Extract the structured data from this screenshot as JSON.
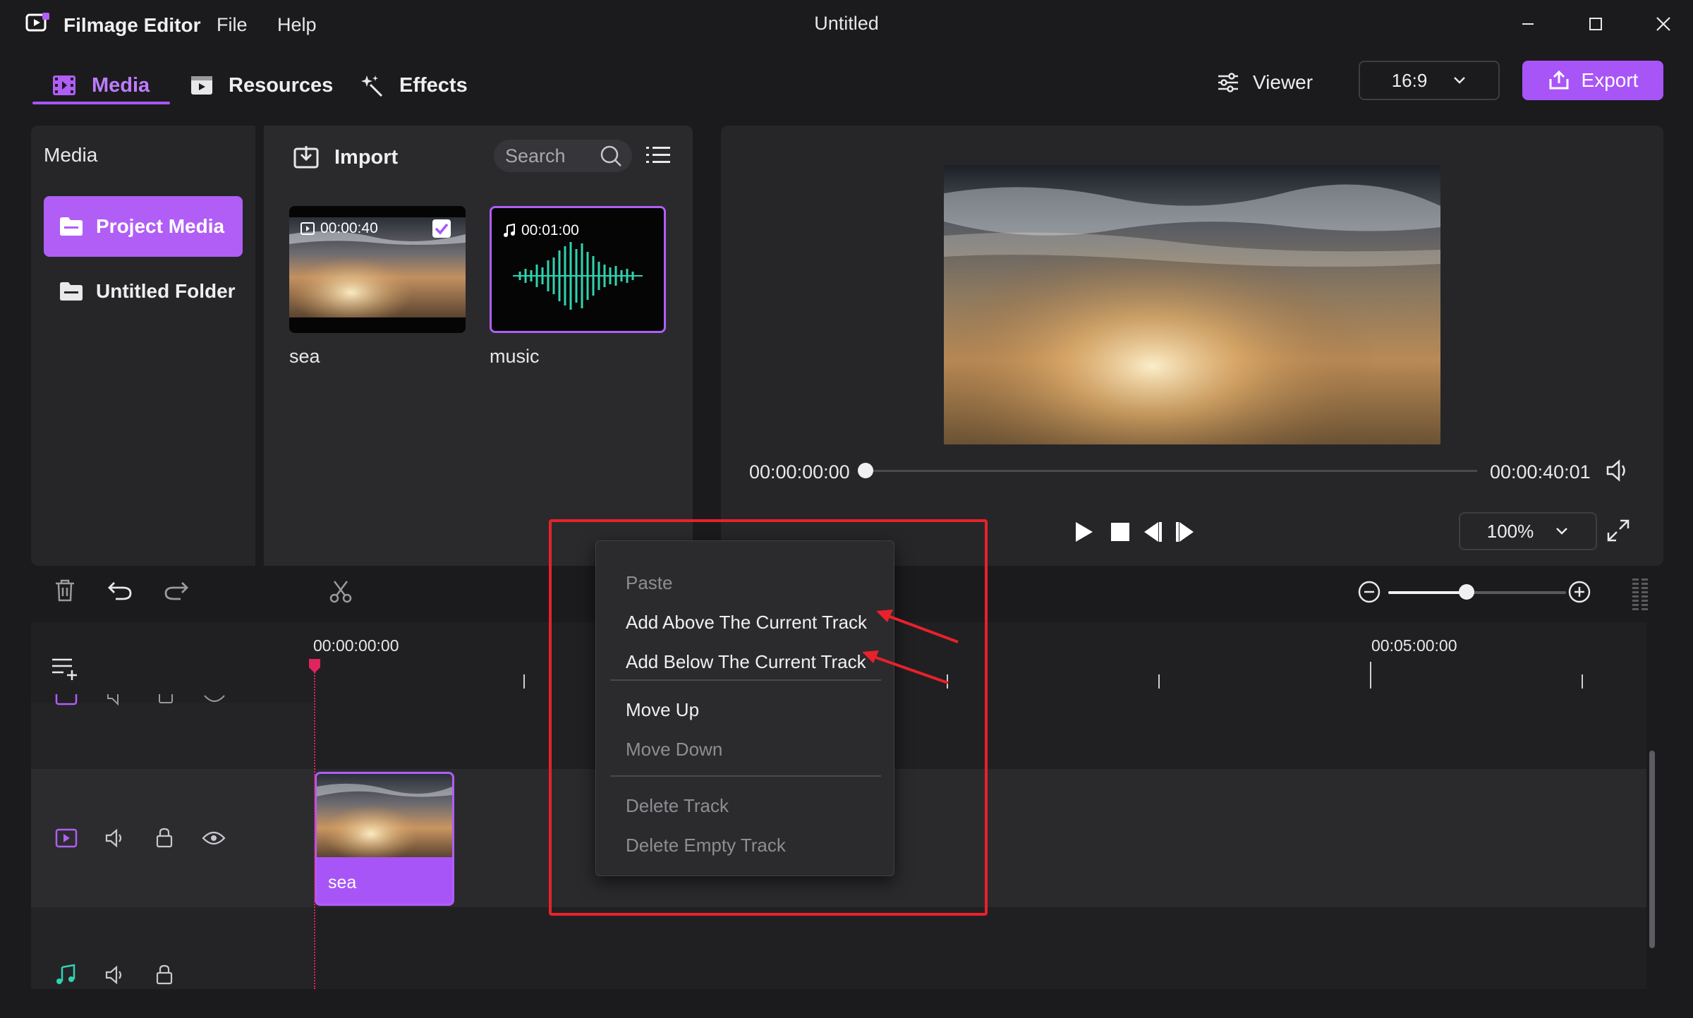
{
  "titlebar": {
    "app_name": "Filmage Editor",
    "menus": [
      "File",
      "Help"
    ],
    "window_title": "Untitled"
  },
  "toolbar": {
    "tabs": [
      {
        "label": "Media",
        "icon": "film-icon",
        "active": true
      },
      {
        "label": "Resources",
        "icon": "play-square-icon",
        "active": false
      },
      {
        "label": "Effects",
        "icon": "sparkle-icon",
        "active": false
      }
    ],
    "viewer_label": "Viewer",
    "aspect_ratio": "16:9",
    "export_label": "Export",
    "accent_color": "#a855f7"
  },
  "media_panel": {
    "heading": "Media",
    "folders": [
      {
        "label": "Project Media",
        "selected": true
      },
      {
        "label": "Untitled Folder",
        "selected": false
      }
    ],
    "import_label": "Import",
    "search_placeholder": "Search",
    "items": [
      {
        "name": "sea",
        "duration": "00:00:40",
        "type": "video",
        "checked": true
      },
      {
        "name": "music",
        "duration": "00:01:00",
        "type": "audio",
        "selected": true
      }
    ]
  },
  "preview": {
    "current_time": "00:00:00:00",
    "total_time": "00:00:40:01",
    "zoom": "100%"
  },
  "timeline": {
    "ruler_start": "00:00:00:00",
    "ruler_mark": "00:05:00:00",
    "clip_label": "sea"
  },
  "context_menu": {
    "items": [
      {
        "label": "Paste",
        "enabled": false
      },
      {
        "label": "Add Above The Current Track",
        "enabled": true
      },
      {
        "label": "Add Below The Current Track",
        "enabled": true
      },
      {
        "label": "Move Up",
        "enabled": true
      },
      {
        "label": "Move Down",
        "enabled": false
      },
      {
        "label": "Delete Track",
        "enabled": false
      },
      {
        "label": "Delete Empty Track",
        "enabled": false
      }
    ]
  },
  "annotation_color": "#e8212b"
}
